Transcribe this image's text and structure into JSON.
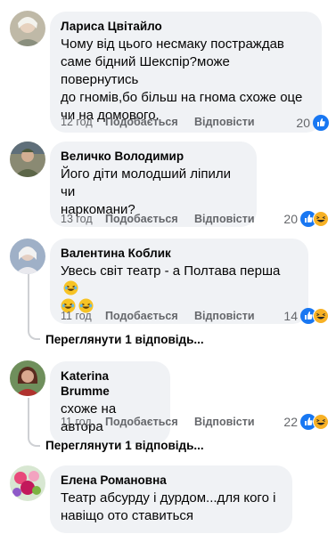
{
  "actions": {
    "like": "Подобається",
    "reply": "Відповісти"
  },
  "comments": [
    {
      "author": "Лариса Цвітайло",
      "lines": [
        "Чому від цього несмаку постраждав",
        "саме бідний Шекспір?може повернутись",
        "до гномів,бо більш на гнома схоже оце",
        "чи на домового."
      ],
      "time": "12 год",
      "reaction_count": "20",
      "reactions": [
        "like-icon"
      ]
    },
    {
      "author": "Величко Володимир",
      "lines": [
        "Його діти молодший ліпили чи",
        "наркомани?"
      ],
      "time": "13 год",
      "reaction_count": "20",
      "reactions": [
        "like-icon",
        "haha-icon"
      ]
    },
    {
      "author": "Валентина Коблик",
      "lines": [
        "Увесь світ театр - а Полтава перша"
      ],
      "emoji": [
        "laughing-emoji",
        "laughing-emoji",
        "laughing-emoji"
      ],
      "time": "11 год",
      "reaction_count": "14",
      "reactions": [
        "like-icon",
        "haha-icon"
      ],
      "view_replies": "Переглянути 1 відповідь..."
    },
    {
      "author": "Katerina Brumme",
      "lines": [
        "схоже на автора"
      ],
      "time": "11 год",
      "reaction_count": "22",
      "reactions": [
        "like-icon",
        "haha-icon"
      ],
      "view_replies": "Переглянути 1 відповідь..."
    },
    {
      "author": "Елена Романовна",
      "lines": [
        "Театр абсурду і дурдом...для кого і",
        "навіщо ото ставиться"
      ]
    }
  ],
  "colors": {
    "bubble": "#f0f2f5",
    "muted_text": "#65676b",
    "like_blue": "#1877f2",
    "haha_yellow": "#f7b125"
  }
}
